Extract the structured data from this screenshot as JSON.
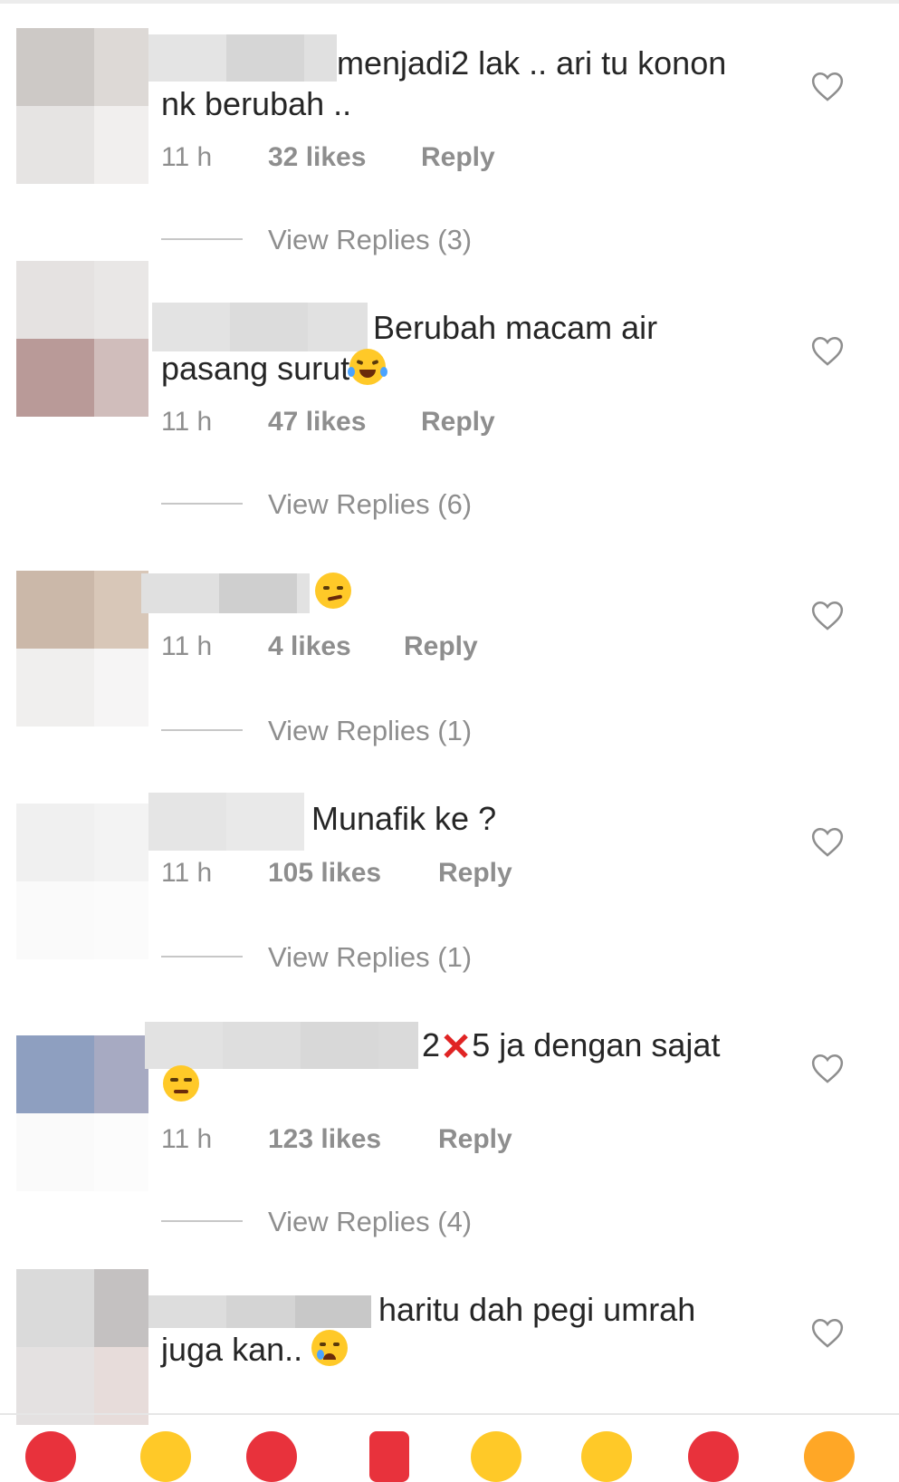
{
  "comments": [
    {
      "text_line1": "menjadi2 lak .. ari tu konon",
      "text_line2": "nk berubah ..",
      "time": "11 h",
      "likes": "32 likes",
      "reply": "Reply",
      "view_replies": "View Replies (3)"
    },
    {
      "text_line1": "Berubah macam air",
      "text_line2": "pasang surut",
      "time": "11 h",
      "likes": "47 likes",
      "reply": "Reply",
      "view_replies": "View Replies (6)"
    },
    {
      "text_line1": "",
      "time": "11 h",
      "likes": "4 likes",
      "reply": "Reply",
      "view_replies": "View Replies (1)"
    },
    {
      "text_line1": "Munafik ke ?",
      "time": "11 h",
      "likes": "105 likes",
      "reply": "Reply",
      "view_replies": "View Replies (1)"
    },
    {
      "text_pre": "2",
      "text_post": "5 ja dengan sajat",
      "time": "11 h",
      "likes": "123 likes",
      "reply": "Reply",
      "view_replies": "View Replies (4)"
    },
    {
      "text_line1": "haritu dah pegi umrah",
      "text_line2": "juga kan.."
    }
  ],
  "icons": {
    "like": "heart-outline-icon",
    "emojis": [
      "tears-of-joy-emoji",
      "smirk-emoji",
      "cross-mark-emoji",
      "unamused-emoji",
      "crying-emoji"
    ]
  },
  "colors": {
    "text": "#262626",
    "meta": "#8e8e8e",
    "redacted": "#d9d9d9"
  }
}
